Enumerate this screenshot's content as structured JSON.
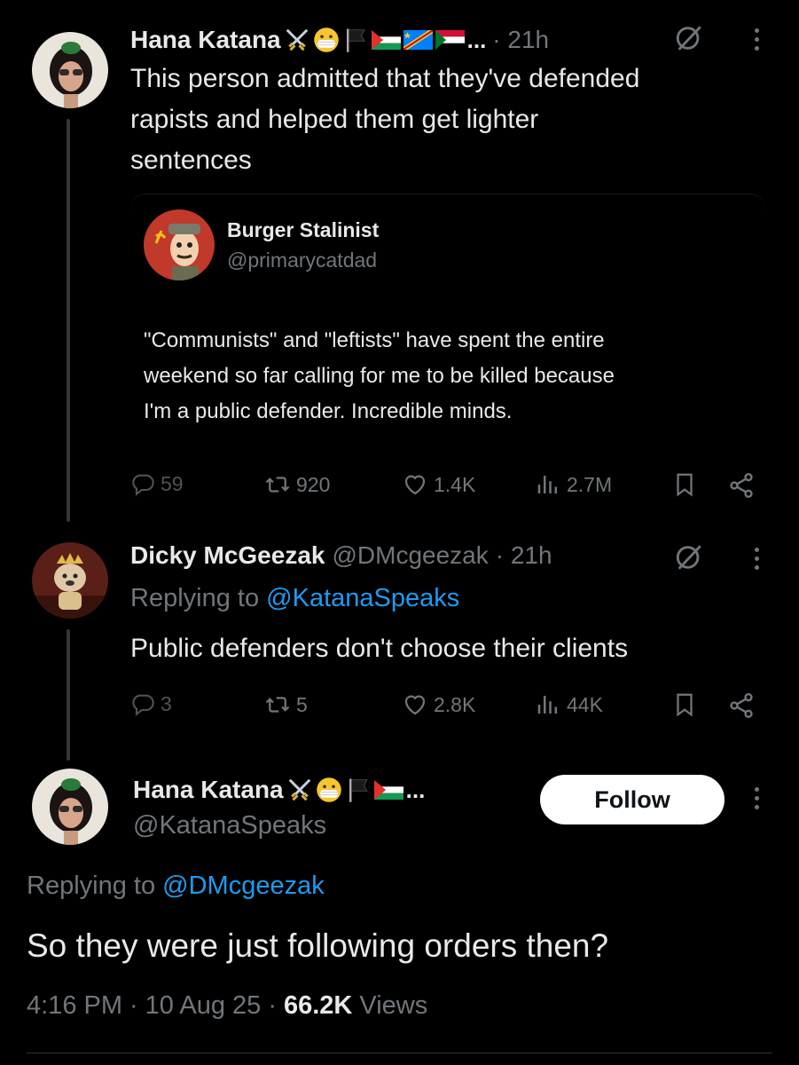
{
  "tweet1": {
    "display_name": "Hana Katana",
    "name_suffix": "...",
    "time": "· 21h",
    "text_line1": "This person admitted that they've defended",
    "text_line2": "rapists and helped them get lighter",
    "text_line3": "sentences",
    "quote": {
      "display_name": "Burger Stalinist",
      "handle": "@primarycatdad",
      "text_line1": "\"Communists\" and \"leftists\" have spent the entire",
      "text_line2": "weekend so far calling for me to be killed because",
      "text_line3": "I'm a public defender. Incredible minds."
    },
    "replies": "59",
    "reposts": "920",
    "likes": "1.4K",
    "views": "2.7M"
  },
  "tweet2": {
    "display_name": "Dicky McGeezak",
    "handle": "@DMcgeezak",
    "time": "· 21h",
    "replying_prefix": "Replying to",
    "replying_handle": "@KatanaSpeaks",
    "text": "Public defenders don't choose their clients",
    "replies": "3",
    "reposts": "5",
    "likes": "2.8K",
    "views": "44K"
  },
  "tweet3": {
    "display_name": "Hana Katana",
    "name_suffix": "...",
    "handle": "@KatanaSpeaks",
    "follow_label": "Follow",
    "replying_prefix": "Replying to",
    "replying_handle": "@DMcgeezak",
    "text": "So they were just following orders then?",
    "time": "4:16 PM",
    "date": "10 Aug 25",
    "views_count": "66.2K",
    "views_label": "Views"
  },
  "colors": {
    "background": "#000000",
    "text": "#e7e9ea",
    "muted": "#71767b",
    "link": "#1d9bf0",
    "thread_line": "#333639"
  },
  "icons": [
    "crossed-swords-icon",
    "mask-face-icon",
    "black-flag-icon",
    "palestine-flag-icon",
    "congo-flag-icon",
    "sudan-flag-icon",
    "grok-icon",
    "more-icon",
    "reply-icon",
    "repost-icon",
    "like-icon",
    "views-icon",
    "bookmark-icon",
    "share-icon"
  ]
}
